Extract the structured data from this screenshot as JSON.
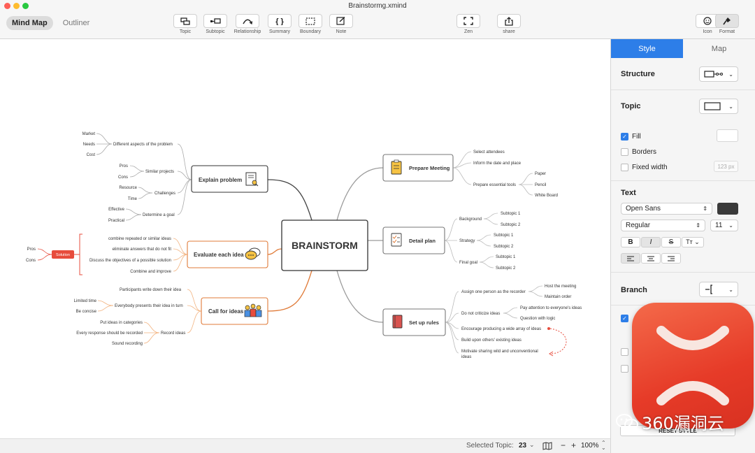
{
  "window": {
    "title": "Brainstormg.xmind"
  },
  "mode_tabs": [
    {
      "label": "Mind Map"
    },
    {
      "label": "Outliner"
    }
  ],
  "toolbar": {
    "topic": "Topic",
    "subtopic": "Subtopic",
    "relationship": "Relationship",
    "summary": "Summary",
    "boundary": "Boundary",
    "note": "Note",
    "zen": "Zen",
    "share": "share",
    "icon": "Icon",
    "format": "Format"
  },
  "panel": {
    "tabs": [
      {
        "label": "Style"
      },
      {
        "label": "Map"
      }
    ],
    "structure_label": "Structure",
    "topic_label": "Topic",
    "fill_label": "Fill",
    "borders_label": "Borders",
    "fixed_width_label": "Fixed width",
    "fixed_width_placeholder": "123 px",
    "text_label": "Text",
    "font_family": "Open Sans",
    "font_weight": "Regular",
    "font_size": "11",
    "branch_label": "Branch",
    "reset_button": "RESET STYLE",
    "fill_checked": true,
    "borders_checked": false,
    "fixed_width_checked": false,
    "accent_color": "#2d7ee8"
  },
  "watermark": {
    "text": "360漏洞云"
  },
  "status": {
    "selected_label": "Selected Topic:",
    "selected_count": "23",
    "zoom_minus": "−",
    "zoom_plus": "+",
    "zoom_level": "100%"
  },
  "mindmap": {
    "central": "BRAINSTORM",
    "explain": {
      "title": "Explain problem",
      "b1": "Different aspects of the problem",
      "b1a": "Market",
      "b1b": "Needs",
      "b1c": "Cost",
      "b2": "Similar projects",
      "b2a": "Pros",
      "b2b": "Cons",
      "b3": "Challenges",
      "b3a": "Resource",
      "b3b": "Time",
      "b4": "Determine a goal",
      "b4a": "Effective",
      "b4b": "Practical"
    },
    "evaluate": {
      "title": "Evaluate each idea",
      "i1": "combine repeated or similar ideas",
      "i2": "eliminate answers that do not fit",
      "i3": "Discuss the objectives of a possible solution",
      "i4": "Combine and improve",
      "summary": "Solution",
      "pros": "Pros",
      "cons": "Cons"
    },
    "call": {
      "title": "Call for ideas",
      "c1": "Participants write down their idea",
      "c2": "Everybody presents their idea in turn",
      "c2a": "Limited time",
      "c2b": "Be concise",
      "c3": "Record ideas",
      "c3a": "Put ideas in categories",
      "c3b": "Every response should be recorded",
      "c3c": "Sound recording"
    },
    "prepare": {
      "title": "Prepare Meeting",
      "p1": "Select attendees",
      "p2": "Inform the date and place",
      "p3": "Prepare essential tools",
      "p3a": "Paper",
      "p3b": "Pencil",
      "p3c": "White Board"
    },
    "detail": {
      "title": "Detail plan",
      "d1": "Background",
      "d1a": "Subtopic 1",
      "d1b": "Subtopic 2",
      "d2": "Strategy",
      "d2a": "Subtopic 1",
      "d2b": "Subtopic 2",
      "d3": "Final goal",
      "d3a": "Subtopic 1",
      "d3b": "Subtopic 2"
    },
    "rules": {
      "title": "Set up rules",
      "r1": "Assign one person as the recorder",
      "r1a": "Host the meeting",
      "r1b": "Maintain order",
      "r2": "Do not criticize ideas",
      "r2a": "Pay attention to everyone's ideas",
      "r2b": "Question with logic",
      "r3": "Encourage producing a wide array of ideas",
      "r4": "Build upon others' existing ideas",
      "r5a": "Motivate sharing wild and unconventional",
      "r5b": "ideas"
    }
  },
  "colors": {
    "dark_branch": "#444444",
    "orange_branch": "#e07b39",
    "gray_branch": "#9a9a9a",
    "red_accent": "#e74c3c",
    "panel_accent": "#2d7ee8"
  }
}
